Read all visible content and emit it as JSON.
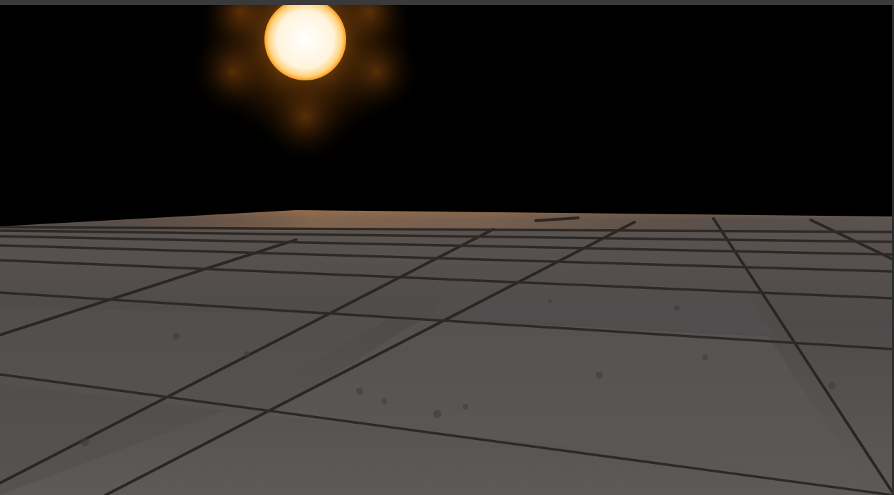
{
  "scene": {
    "sky_color": "#000000",
    "sun_core_color": "#fffaf0",
    "sun_glow_color": "#ff9a1e",
    "floor_color": "#5e5b58",
    "floor_grout_color": "#2a2623",
    "frame_color": "#2d2d2d"
  }
}
